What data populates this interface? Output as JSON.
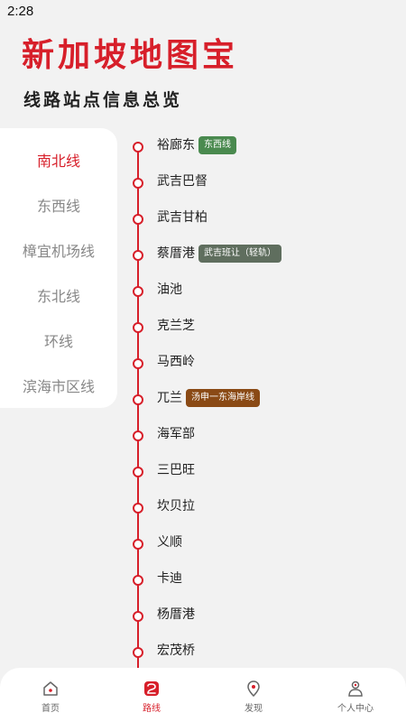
{
  "status_bar": {
    "time": "2:28"
  },
  "header": {
    "title": "新加坡地图宝",
    "subtitle": "线路站点信息总览"
  },
  "line_menu": {
    "items": [
      {
        "label": "南北线",
        "active": true
      },
      {
        "label": "东西线",
        "active": false
      },
      {
        "label": "樟宜机场线",
        "active": false
      },
      {
        "label": "东北线",
        "active": false
      },
      {
        "label": "环线",
        "active": false
      },
      {
        "label": "滨海市区线",
        "active": false
      }
    ]
  },
  "stations": [
    {
      "name": "裕廊东",
      "badge": "东西线",
      "badge_color": "#4a8a4f"
    },
    {
      "name": "武吉巴督"
    },
    {
      "name": "武吉甘柏"
    },
    {
      "name": "蔡厝港",
      "badge": "武吉班让（轻轨）",
      "badge_color": "#5f6e5e"
    },
    {
      "name": "油池"
    },
    {
      "name": "克兰芝"
    },
    {
      "name": "马西岭"
    },
    {
      "name": "兀兰",
      "badge": "汤申一东海岸线",
      "badge_color": "#8a4a15"
    },
    {
      "name": "海军部"
    },
    {
      "name": "三巴旺"
    },
    {
      "name": "坎贝拉"
    },
    {
      "name": "义顺"
    },
    {
      "name": "卡迪"
    },
    {
      "name": "杨厝港"
    },
    {
      "name": "宏茂桥"
    }
  ],
  "bottom_nav": {
    "items": [
      {
        "label": "首页",
        "icon": "home-icon",
        "active": false
      },
      {
        "label": "路线",
        "icon": "route-icon",
        "active": true
      },
      {
        "label": "发现",
        "icon": "map-pin-icon",
        "active": false
      },
      {
        "label": "个人中心",
        "icon": "user-icon",
        "active": false
      }
    ]
  },
  "colors": {
    "accent": "#d71f2a",
    "text": "#222222",
    "muted": "#888888"
  }
}
